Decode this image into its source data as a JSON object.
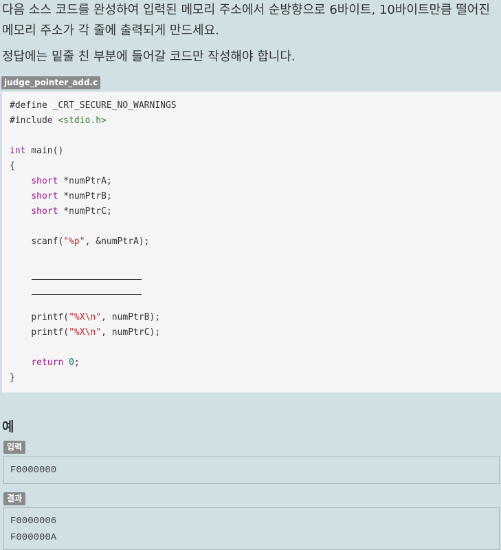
{
  "problem": {
    "paragraph1": "다음 소스 코드를 완성하여 입력된 메모리 주소에서 순방향으로 6바이트, 10바이트만큼 떨어진 메모리 주소가 각 줄에 출력되게 만드세요.",
    "paragraph2": "정답에는 밑줄 친 부분에 들어갈 코드만 작성해야 합니다."
  },
  "file": {
    "name": "judge_pointer_add.c"
  },
  "code": {
    "l1": "#define _CRT_SECURE_NO_WARNINGS",
    "l2_pre": "#include ",
    "l2_inc": "<stdio.h>",
    "l4_kw": "int",
    "l4_rest": " main()",
    "l5": "{",
    "l6_kw": "short",
    "l6_rest": " *numPtrA;",
    "l7_kw": "short",
    "l7_rest": " *numPtrB;",
    "l8_kw": "short",
    "l8_rest": " *numPtrC;",
    "l10_pre": "scanf(",
    "l10_str": "\"%p\"",
    "l10_post": ", &numPtrA);",
    "l15_pre": "printf(",
    "l15_str": "\"%X\\n\"",
    "l15_post": ", numPtrB);",
    "l16_pre": "printf(",
    "l16_str": "\"%X\\n\"",
    "l16_post": ", numPtrC);",
    "l18_kw": "return",
    "l18_num": "0",
    "l18_post": ";",
    "l19": "}"
  },
  "example": {
    "title": "예",
    "input_label": "입력",
    "input_lines": [
      "F0000000"
    ],
    "output_label": "결과",
    "output_lines": [
      "F0000006",
      "F000000A"
    ]
  }
}
